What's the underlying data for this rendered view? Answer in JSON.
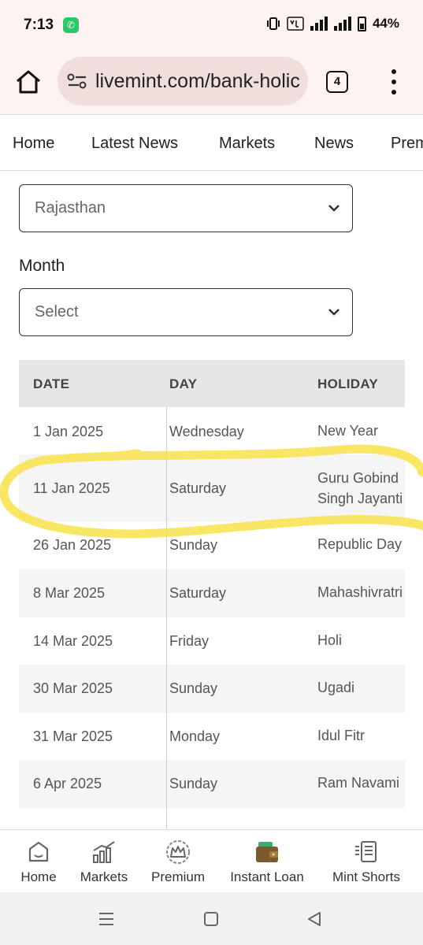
{
  "status_bar": {
    "time": "7:13",
    "battery": "44%"
  },
  "browser": {
    "url": "livemint.com/bank-holic",
    "tab_count": "4"
  },
  "site_nav": {
    "items": [
      "Home",
      "Latest News",
      "Markets",
      "News",
      "Prem"
    ]
  },
  "filters": {
    "state_value": "Rajasthan",
    "month_label": "Month",
    "month_value": "Select"
  },
  "table": {
    "headers": [
      "DATE",
      "DAY",
      "HOLIDAY"
    ],
    "rows": [
      {
        "date": "1 Jan 2025",
        "day": "Wednesday",
        "holiday": "New Year"
      },
      {
        "date": "11 Jan 2025",
        "day": "Saturday",
        "holiday": "Guru Gobind Singh Jayanti"
      },
      {
        "date": "26 Jan 2025",
        "day": "Sunday",
        "holiday": "Republic Day"
      },
      {
        "date": "8 Mar 2025",
        "day": "Saturday",
        "holiday": "Mahashivratri"
      },
      {
        "date": "14 Mar 2025",
        "day": "Friday",
        "holiday": "Holi"
      },
      {
        "date": "30 Mar 2025",
        "day": "Sunday",
        "holiday": "Ugadi"
      },
      {
        "date": "31 Mar 2025",
        "day": "Monday",
        "holiday": "Idul Fitr"
      },
      {
        "date": "6 Apr 2025",
        "day": "Sunday",
        "holiday": "Ram Navami"
      }
    ]
  },
  "bottom_nav": {
    "items": [
      {
        "label": "Home",
        "icon": "home-icon"
      },
      {
        "label": "Markets",
        "icon": "markets-chart-icon"
      },
      {
        "label": "Premium",
        "icon": "premium-crown-icon"
      },
      {
        "label": "Instant Loan",
        "icon": "wallet-icon"
      },
      {
        "label": "Mint Shorts",
        "icon": "shorts-icon"
      }
    ]
  },
  "colors": {
    "highlight": "#f9e24a",
    "browser_bg": "#fdf3f1",
    "url_pill": "#f0dedd",
    "header_bg": "#e6e6e6"
  }
}
